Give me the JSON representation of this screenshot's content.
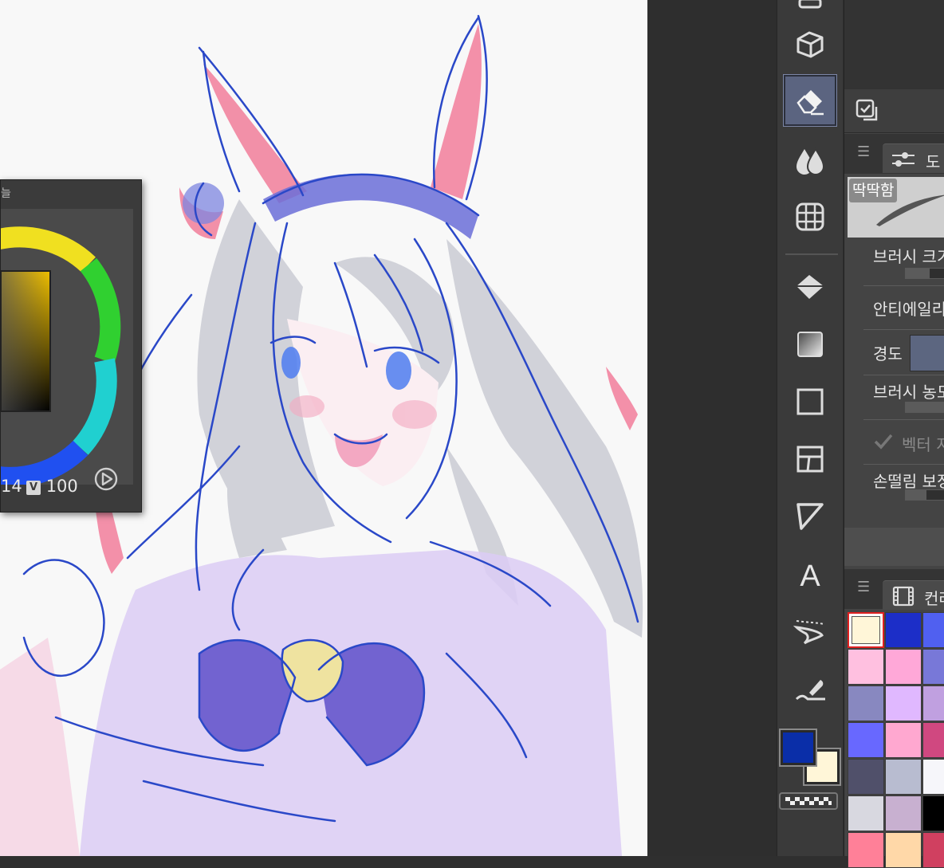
{
  "colors": {
    "accent_main": "#0a2ea8",
    "accent_sub": "#fff6d8",
    "active_tool_bg": "#5b6480"
  },
  "color_popup": {
    "title_fragment": "늘",
    "hsv_s_partial": "14",
    "v_label": "V",
    "v_value": "100",
    "play_icon": "play-circle-icon"
  },
  "toolbar": {
    "tools": [
      {
        "name": "top-partial-icon"
      },
      {
        "name": "eraser-block-icon"
      },
      {
        "name": "eraser-icon",
        "active": true
      },
      {
        "name": "blend-drops-icon"
      },
      {
        "name": "figure-ruler-icon"
      },
      {
        "name": "fill-bucket-icon"
      },
      {
        "name": "gradient-icon"
      },
      {
        "name": "rectangle-icon"
      },
      {
        "name": "frame-border-icon"
      },
      {
        "name": "ruler-icon"
      },
      {
        "name": "text-icon",
        "glyph": "A"
      },
      {
        "name": "balloon-icon"
      },
      {
        "name": "correct-line-icon"
      }
    ]
  },
  "tool_property": {
    "tab_label": "도",
    "brush_preset": "딱딱함",
    "brush_size_label": "브러시 크기",
    "antialias_label": "안티에일리",
    "hardness_label": "경도",
    "brush_density_label": "브러시 농도",
    "vector_label": "벡터 지",
    "stabilization_label": "손떨림 보정"
  },
  "color_set": {
    "tab_label": "컨러",
    "rows": [
      [
        "#fff6d8",
        "#1c2ec8",
        "#5060f0"
      ],
      [
        "#ffc0e0",
        "#ffa8d8",
        "#7878d8"
      ],
      [
        "#8888c0",
        "#e0b8ff",
        "#c0a0e0"
      ],
      [
        "#6868ff",
        "#ffa8d0",
        "#d04880"
      ],
      [
        "#50506a",
        "#b8bcd0",
        "#f6f6fa"
      ],
      [
        "#d8d8e0",
        "#c8b0d0",
        "#000000"
      ],
      [
        "#ff8098",
        "#ffd8a8",
        "#d04060"
      ]
    ]
  }
}
